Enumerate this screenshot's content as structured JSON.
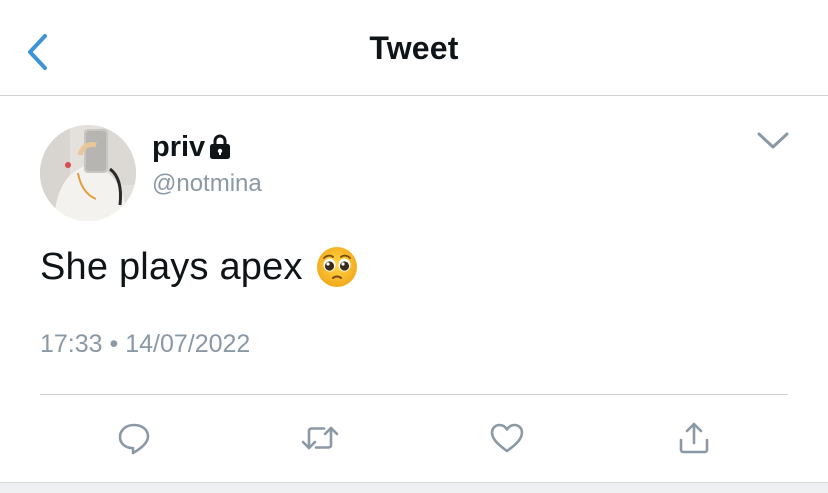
{
  "navbar": {
    "title": "Tweet",
    "back_icon": "chevron-left-icon",
    "accent_color": "#3b94d9"
  },
  "tweet": {
    "display_name": "priv",
    "protected_icon": "lock-icon",
    "handle": "@notmina",
    "text": "She plays apex",
    "emoji": "pleading-face-emoji",
    "timestamp": "17:33 • 14/07/2022",
    "menu_icon": "chevron-down-icon"
  },
  "actions": [
    {
      "name": "reply",
      "icon": "reply-icon"
    },
    {
      "name": "retweet",
      "icon": "retweet-icon"
    },
    {
      "name": "like",
      "icon": "heart-icon"
    },
    {
      "name": "share",
      "icon": "share-icon"
    }
  ],
  "colors": {
    "text_primary": "#0f1419",
    "text_secondary": "#8b98a5",
    "icon_gray": "#8b98a5",
    "divider": "#cfd3d6"
  }
}
